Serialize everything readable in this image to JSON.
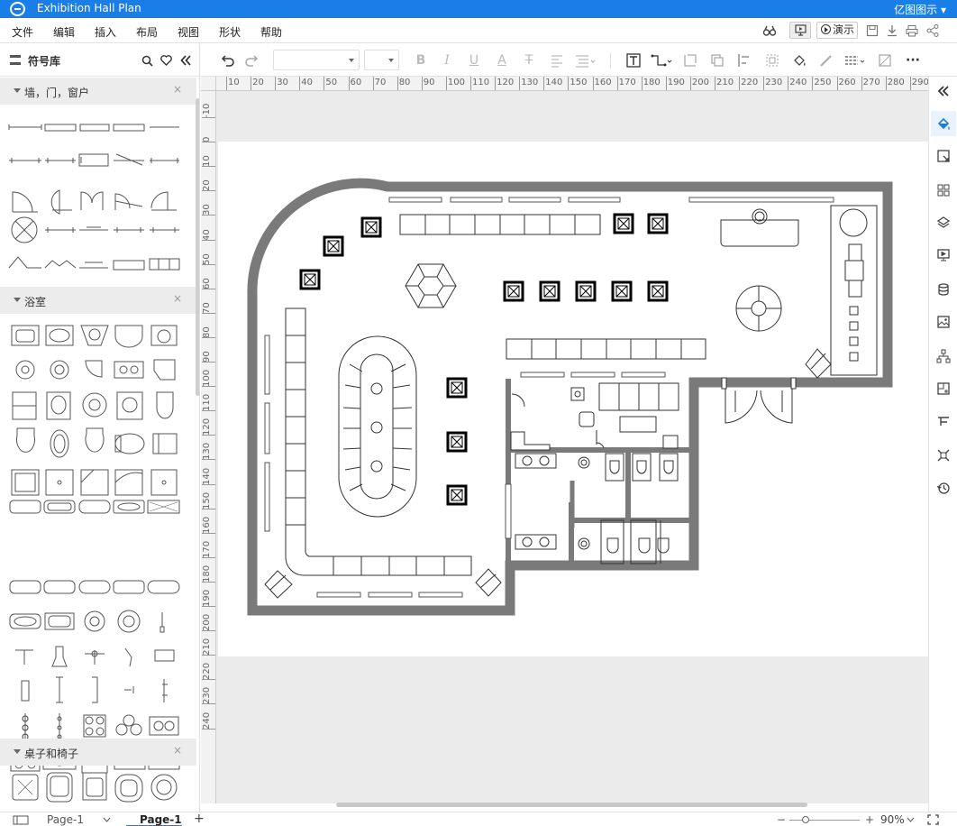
{
  "app": {
    "title": "Exhibition Hall Plan",
    "brand": "亿图图示",
    "brand_caret": "▾"
  },
  "menu": [
    "文件",
    "编辑",
    "插入",
    "布局",
    "视图",
    "形状",
    "帮助"
  ],
  "menubar_right": {
    "present_label": "演示",
    "icons": [
      "binoculars-icon",
      "screen-icon",
      "present-icon",
      "save-icon",
      "download-icon",
      "print-icon",
      "share-icon"
    ]
  },
  "library": {
    "title": "符号库",
    "sections": [
      {
        "title": "墙，门，窗户",
        "close": "×"
      },
      {
        "title": "浴室",
        "close": "×"
      },
      {
        "title": "桌子和椅子",
        "close": "×"
      }
    ]
  },
  "toolbar": {
    "icons": [
      "undo-icon",
      "redo-icon",
      "font-family-select",
      "font-size-select",
      "bold-icon",
      "italic-icon",
      "underline-icon",
      "font-color-icon",
      "text-style-icon",
      "align-icon",
      "line-spacing-icon",
      "text-box-icon",
      "connector-icon",
      "container-icon",
      "group-icon",
      "align-shapes-icon",
      "arrange-icon",
      "fill-icon",
      "line-color-icon",
      "line-style-icon",
      "shadow-icon",
      "more-icon"
    ],
    "glyphs": {
      "bold": "B",
      "italic": "I",
      "underline": "U",
      "font_color": "A",
      "text_style": "T",
      "more": "···"
    }
  },
  "ruler": {
    "top": [
      "10",
      "20",
      "30",
      "40",
      "50",
      "60",
      "70",
      "80",
      "90",
      "100",
      "110",
      "120",
      "130",
      "140",
      "150",
      "160",
      "170",
      "180",
      "190",
      "200",
      "210",
      "220",
      "230",
      "240",
      "250",
      "260",
      "270",
      "280",
      "290"
    ],
    "left": [
      "-10",
      "0",
      "10",
      "20",
      "30",
      "40",
      "50",
      "60",
      "70",
      "80",
      "90",
      "100",
      "110",
      "120",
      "130",
      "140",
      "150",
      "160",
      "170",
      "180",
      "190",
      "200",
      "210",
      "220",
      "230",
      "240"
    ]
  },
  "rightbar": {
    "icons": [
      "collapse-icon",
      "fill-style-icon",
      "format-icon",
      "grid-icon",
      "layers-icon",
      "presentation-icon",
      "database-icon",
      "image-icon",
      "org-chart-icon",
      "attribute-icon",
      "guide-icon",
      "replace-icon",
      "history-icon"
    ]
  },
  "status": {
    "page_selector": "Page-1",
    "current_page": "Page-1",
    "add_page": "+",
    "zoom": "90%",
    "zoom_minus": "−",
    "zoom_plus": "+"
  }
}
